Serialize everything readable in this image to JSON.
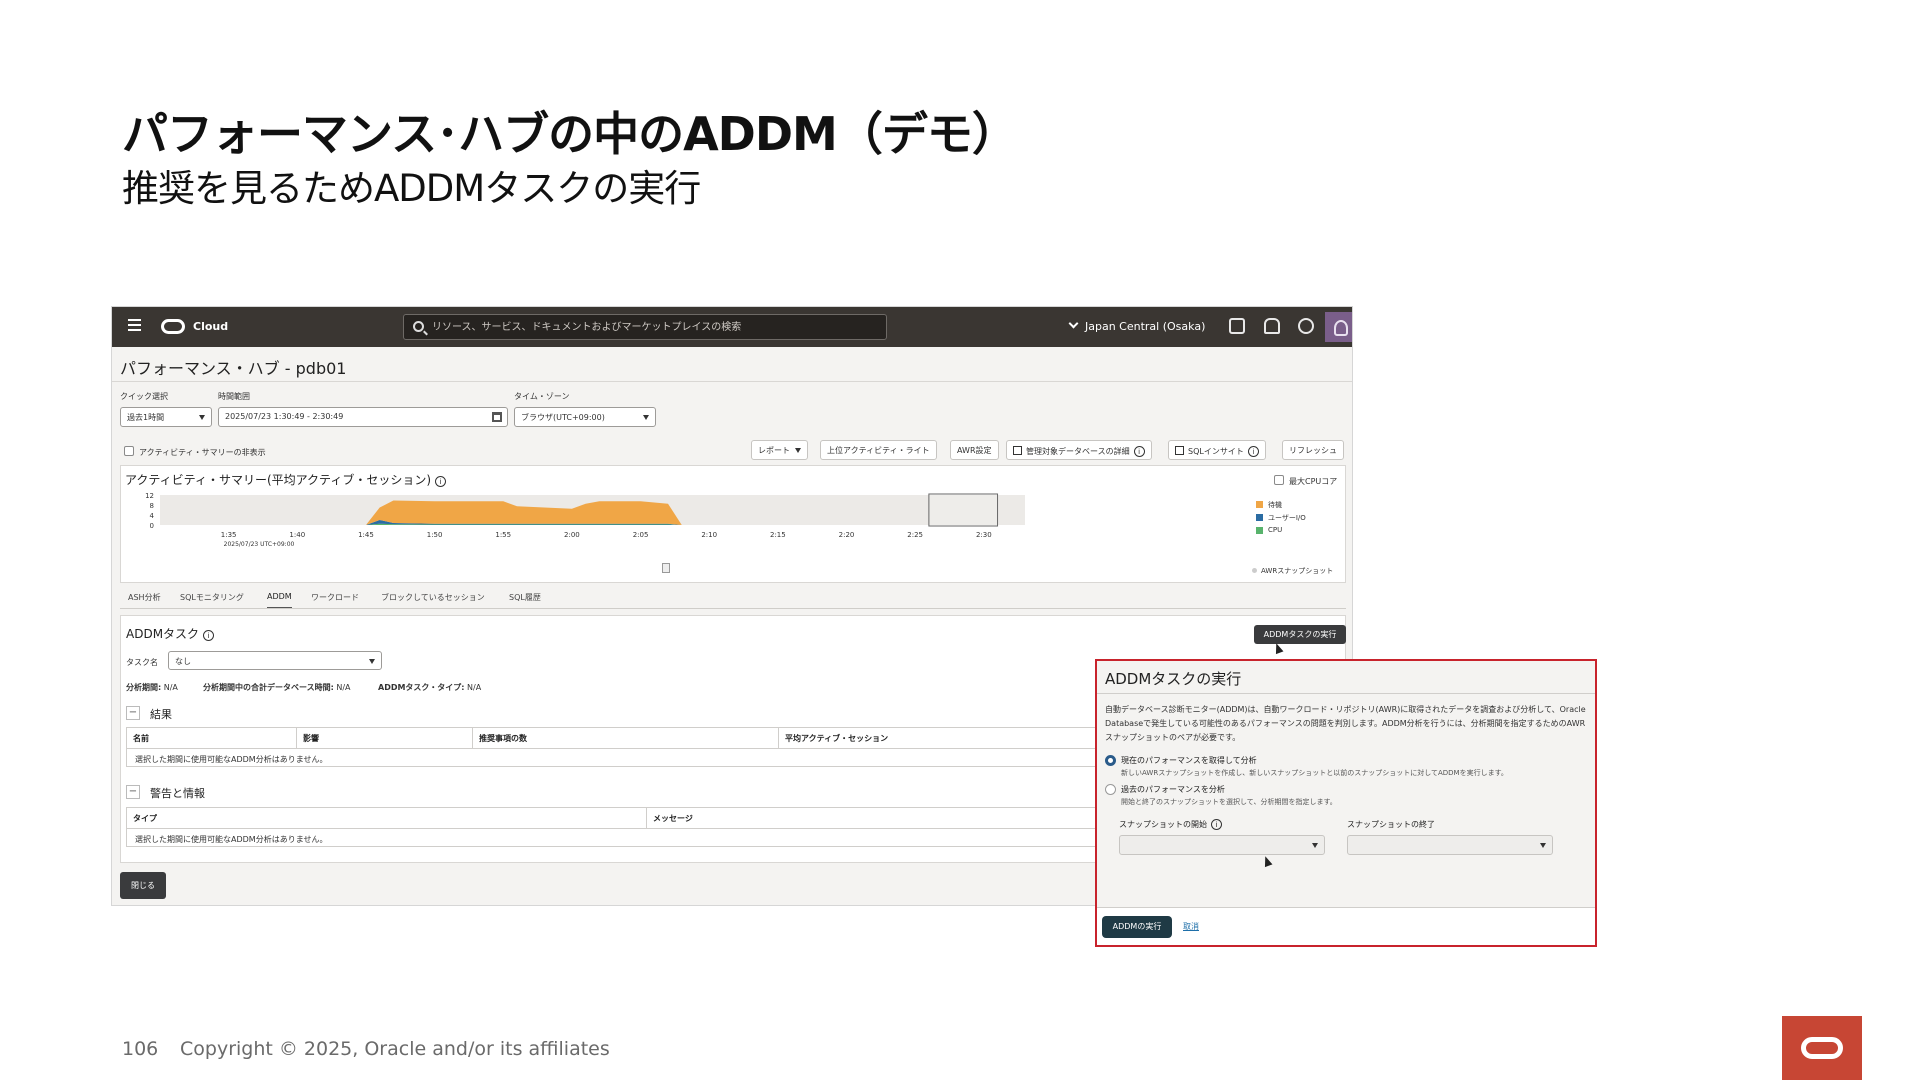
{
  "slide": {
    "title": "パフォーマンス･ハブの中のADDM（デモ）",
    "subtitle": "推奨を見るためADDMタスクの実行",
    "page_number": "106",
    "copyright": "Copyright © 2025, Oracle and/or its affiliates"
  },
  "topbar": {
    "brand": "Cloud",
    "search_placeholder": "リソース、サービス、ドキュメントおよびマーケットプレイスの検索",
    "region": "Japan Central (Osaka)"
  },
  "page": {
    "heading": "パフォーマンス・ハブ - pdb01"
  },
  "filters": {
    "quick_select_label": "クイック選択",
    "quick_select_value": "過去1時間",
    "time_range_label": "時間範囲",
    "time_range_value": "2025/07/23 1:30:49 - 2:30:49",
    "timezone_label": "タイム・ゾーン",
    "timezone_value": "ブラウザ(UTC+09:00)"
  },
  "toolbar": {
    "hide_summary": "アクティビティ・サマリーの非表示",
    "report": "レポート",
    "top_activity_lite": "上位アクティビティ・ライト",
    "awr_settings": "AWR設定",
    "managed_db_details": "管理対象データベースの詳細",
    "sql_insight": "SQLインサイト",
    "refresh": "リフレッシュ"
  },
  "chart_data": {
    "type": "area",
    "title": "アクティビティ・サマリー(平均アクティブ・セッション)",
    "max_cpu_core_label": "最大CPUコア",
    "y_ticks": [
      "12",
      "8",
      "4",
      "0"
    ],
    "ylim": [
      0,
      12
    ],
    "x_ticks": [
      "1:35",
      "1:40",
      "1:45",
      "1:50",
      "1:55",
      "2:00",
      "2:05",
      "2:10",
      "2:15",
      "2:20",
      "2:25",
      "2:30"
    ],
    "x_start_label": "2025/07/23 UTC+09:00",
    "x": [
      "1:30",
      "1:45",
      "1:46",
      "1:47",
      "1:50",
      "1:55",
      "1:56",
      "2:00",
      "2:01",
      "2:02",
      "2:05",
      "2:07",
      "2:08",
      "2:30"
    ],
    "series": [
      {
        "name": "待機",
        "color": "#f0a646",
        "values": [
          0,
          0,
          5,
          9,
          9,
          9,
          7,
          6,
          8,
          9,
          9,
          8,
          0,
          0
        ]
      },
      {
        "name": "ユーザーI/O",
        "color": "#2b6ca3",
        "values": [
          0,
          0,
          1.5,
          0.5,
          0.3,
          0.3,
          0.3,
          0.3,
          0.3,
          0.3,
          0.3,
          0.3,
          0,
          0
        ]
      },
      {
        "name": "CPU",
        "color": "#58b36c",
        "values": [
          0,
          0,
          0.5,
          0.3,
          0.2,
          0.2,
          0.2,
          0.2,
          0.2,
          0.2,
          0.2,
          0.2,
          0,
          0
        ]
      }
    ],
    "snapshot_label": "AWRスナップショット"
  },
  "tabs": [
    "ASH分析",
    "SQLモニタリング",
    "ADDM",
    "ワークロード",
    "ブロックしているセッション",
    "SQL履歴"
  ],
  "addm": {
    "title": "ADDMタスク",
    "task_name_label": "タスク名",
    "task_name_value": "なし",
    "run_button": "ADDMタスクの実行",
    "period_label": "分析期間:",
    "period_value": "N/A",
    "db_time_label": "分析期間中の合計データベース時間:",
    "db_time_value": "N/A",
    "task_type_label": "ADDMタスク・タイプ:",
    "task_type_value": "N/A",
    "results_title": "結果",
    "results_columns": [
      "名前",
      "影響",
      "推奨事項の数",
      "平均アクティブ・セッション"
    ],
    "results_empty": "選択した期間に使用可能なADDM分析はありません。",
    "warnings_title": "警告と情報",
    "warnings_columns": [
      "タイプ",
      "メッセージ"
    ],
    "warnings_empty": "選択した期間に使用可能なADDM分析はありません。",
    "close_button": "閉じる"
  },
  "modal": {
    "title": "ADDMタスクの実行",
    "description": "自動データベース診断モニター(ADDM)は、自動ワークロード・リポジトリ(AWR)に取得されたデータを調査および分析して、Oracle Databaseで発生している可能性のあるパフォーマンスの問題を判別します。ADDM分析を行うには、分析期間を指定するためのAWRスナップショットのペアが必要です。",
    "option1_label": "現在のパフォーマンスを取得して分析",
    "option1_desc": "新しいAWRスナップショットを作成し、新しいスナップショットと以前のスナップショットに対してADDMを実行します。",
    "option2_label": "過去のパフォーマンスを分析",
    "option2_desc": "開始と終了のスナップショットを選択して、分析期間を指定します。",
    "snapshot_start_label": "スナップショットの開始",
    "snapshot_end_label": "スナップショットの終了",
    "run_button": "ADDMの実行",
    "cancel_link": "取消"
  }
}
